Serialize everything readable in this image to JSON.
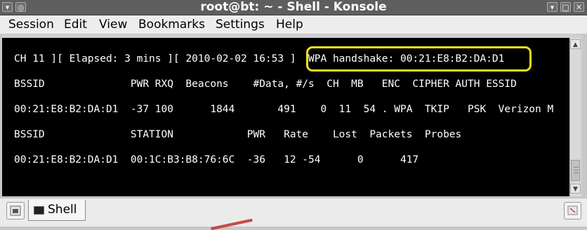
{
  "window": {
    "title": "root@bt: ~ - Shell - Konsole",
    "buttons": {
      "minimize": "▾",
      "maximize": "▢",
      "close": "✕"
    }
  },
  "menu": [
    "Session",
    "Edit",
    "View",
    "Bookmarks",
    "Settings",
    "Help"
  ],
  "terminal": {
    "lines": [
      "CH 11 ][ Elapsed: 3 mins ][ 2010-02-02 16:53 ]  WPA handshake: 00:21:E8:B2:DA:D1",
      "BSSID              PWR RXQ  Beacons    #Data, #/s  CH  MB   ENC  CIPHER AUTH ESSID",
      "00:21:E8:B2:DA:D1  -37 100      1844       491    0  11  54 . WPA  TKIP   PSK  Verizon M",
      "BSSID              STATION            PWR   Rate    Lost  Packets  Probes",
      "00:21:E8:B2:DA:D1  00:1C:B3:B8:76:6C  -36   12 -54      0      417"
    ],
    "highlight_color": "#f0e21a"
  },
  "tabs": [
    {
      "label": "Shell",
      "icon": "terminal-icon"
    }
  ]
}
